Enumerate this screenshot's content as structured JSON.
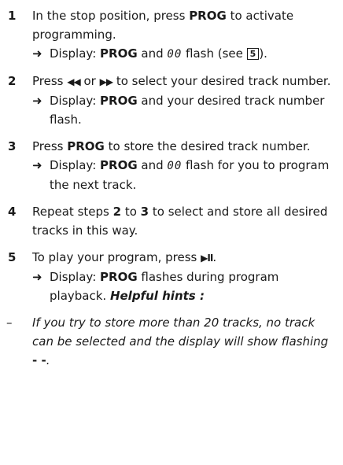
{
  "steps": [
    {
      "num": "1",
      "pre": "In the stop position, press ",
      "bold": "PROG",
      "post": " to activate programming.",
      "result": {
        "arrow": "➜",
        "pre": " Display: ",
        "bold": "PROG",
        "mid": " and ",
        "seg": "00",
        "post": " flash (see ",
        "box": "5",
        "end": ")."
      }
    },
    {
      "num": "2",
      "pre": "Press ",
      "prev_symbol": "◀◀",
      "mid": " or ",
      "next_symbol": "▶▶",
      "post": " to select your desired track number.",
      "result": {
        "arrow": "➜",
        "pre": " Display: ",
        "bold": "PROG",
        "post": " and your desired track number flash."
      }
    },
    {
      "num": "3",
      "pre": "Press ",
      "bold": "PROG",
      "post": " to store the desired track number.",
      "result": {
        "arrow": "➜",
        "pre": " Display: ",
        "bold": "PROG",
        "mid": " and ",
        "seg": "00",
        "post": " flash for you to program the next track."
      }
    },
    {
      "num": "4",
      "pre": "Repeat steps ",
      "bold1": "2",
      "mid": " to ",
      "bold2": "3",
      "post": " to select and store all desired tracks in this way."
    },
    {
      "num": "5",
      "pre": "To play your program, press ",
      "play_symbol": "▶II",
      "post": ".",
      "result": {
        "arrow": "➜",
        "pre": " Display: ",
        "bold": "PROG",
        "post": " flashes during program playback. ",
        "hints_title": "Helpful hints :"
      }
    }
  ],
  "hint": {
    "dash": "–",
    "text": "If you try to store more than 20 tracks, no track can be selected and the display will show flashing ",
    "flash": "- -",
    "end": "."
  }
}
